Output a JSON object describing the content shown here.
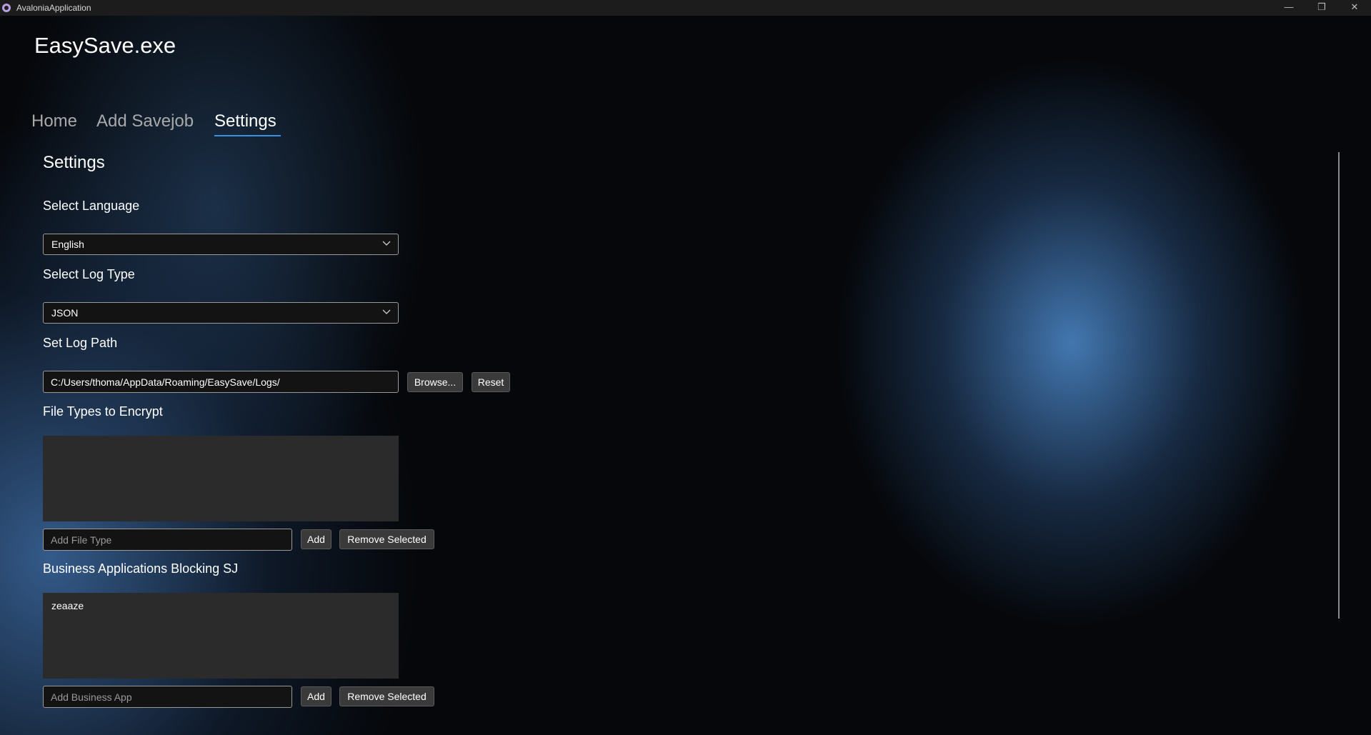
{
  "window": {
    "title": "AvaloniaApplication"
  },
  "app": {
    "heading": "EasySave.exe"
  },
  "tabs": [
    "Home",
    "Add Savejob",
    "Settings"
  ],
  "settings": {
    "title": "Settings",
    "language_label": "Select Language",
    "language_value": "English",
    "log_type_label": "Select Log Type",
    "log_type_value": "JSON",
    "log_path_label": "Set Log Path",
    "log_path_value": "C:/Users/thoma/AppData/Roaming/EasySave/Logs/",
    "browse_label": "Browse...",
    "reset_label": "Reset",
    "encrypt_label": "File Types to Encrypt",
    "encrypt_items": [],
    "add_file_type_placeholder": "Add File Type",
    "add_label": "Add",
    "remove_selected_label": "Remove Selected",
    "business_label": "Business Applications Blocking SJ",
    "business_items": [
      "zeaaze"
    ],
    "add_business_placeholder": "Add Business App"
  },
  "icons": {
    "app": "avalonia-logo-icon",
    "minimize": "minimize-icon",
    "maximize": "restore-icon",
    "close": "close-icon",
    "dropdown": "chevron-down-icon"
  },
  "colors": {
    "accent": "#3d8fe0",
    "titlebar": "#1c1c1c",
    "list_background": "#2b2b2b",
    "button_background": "#3a3a3a"
  }
}
